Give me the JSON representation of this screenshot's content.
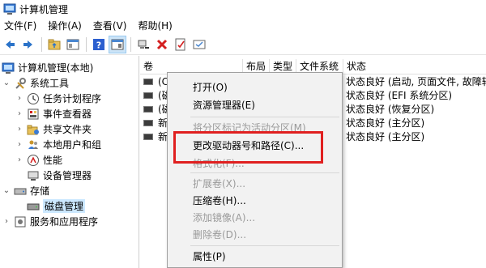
{
  "window": {
    "title": "计算机管理"
  },
  "menubar": [
    "文件(F)",
    "操作(A)",
    "查看(V)",
    "帮助(H)"
  ],
  "toolbar": {
    "icons": [
      "back-arrow-icon",
      "forward-arrow-icon",
      "up-folder-icon",
      "show-hide-tree-icon",
      "help-icon",
      "properties-icon",
      "connect-icon",
      "delete-icon",
      "check-icon",
      "refresh-icon"
    ],
    "colors": {
      "arrow": "#2b73c9",
      "delete": "#d42020",
      "help": "#2b5fcf"
    }
  },
  "tree": {
    "root": "计算机管理(本地)",
    "system_tools": "系统工具",
    "task_scheduler": "任务计划程序",
    "event_viewer": "事件查看器",
    "shared_folders": "共享文件夹",
    "local_users": "本地用户和组",
    "performance": "性能",
    "device_manager": "设备管理器",
    "storage": "存储",
    "disk_management": "磁盘管理",
    "services_apps": "服务和应用程序"
  },
  "table": {
    "columns": [
      "卷",
      "布局",
      "类型",
      "文件系统",
      "状态"
    ],
    "rows": [
      {
        "volume": "(C",
        "status": "状态良好 (启动, 页面文件, 故障转储"
      },
      {
        "volume": "(磁",
        "status": "状态良好 (EFI 系统分区)"
      },
      {
        "volume": "(磁",
        "status": "状态良好 (恢复分区)"
      },
      {
        "volume": "新",
        "status": "状态良好 (主分区)"
      },
      {
        "volume": "新",
        "status": "状态良好 (主分区)"
      }
    ]
  },
  "context_menu": {
    "open": "打开(O)",
    "explorer": "资源管理器(E)",
    "mark_active": "将分区标记为活动分区(M)",
    "change_letter": "更改驱动器号和路径(C)...",
    "format": "格式化(F)...",
    "extend": "扩展卷(X)...",
    "shrink": "压缩卷(H)...",
    "add_mirror": "添加镜像(A)...",
    "delete": "删除卷(D)...",
    "properties": "属性(P)"
  },
  "annotation": {
    "highlight_color": "#e02020"
  }
}
